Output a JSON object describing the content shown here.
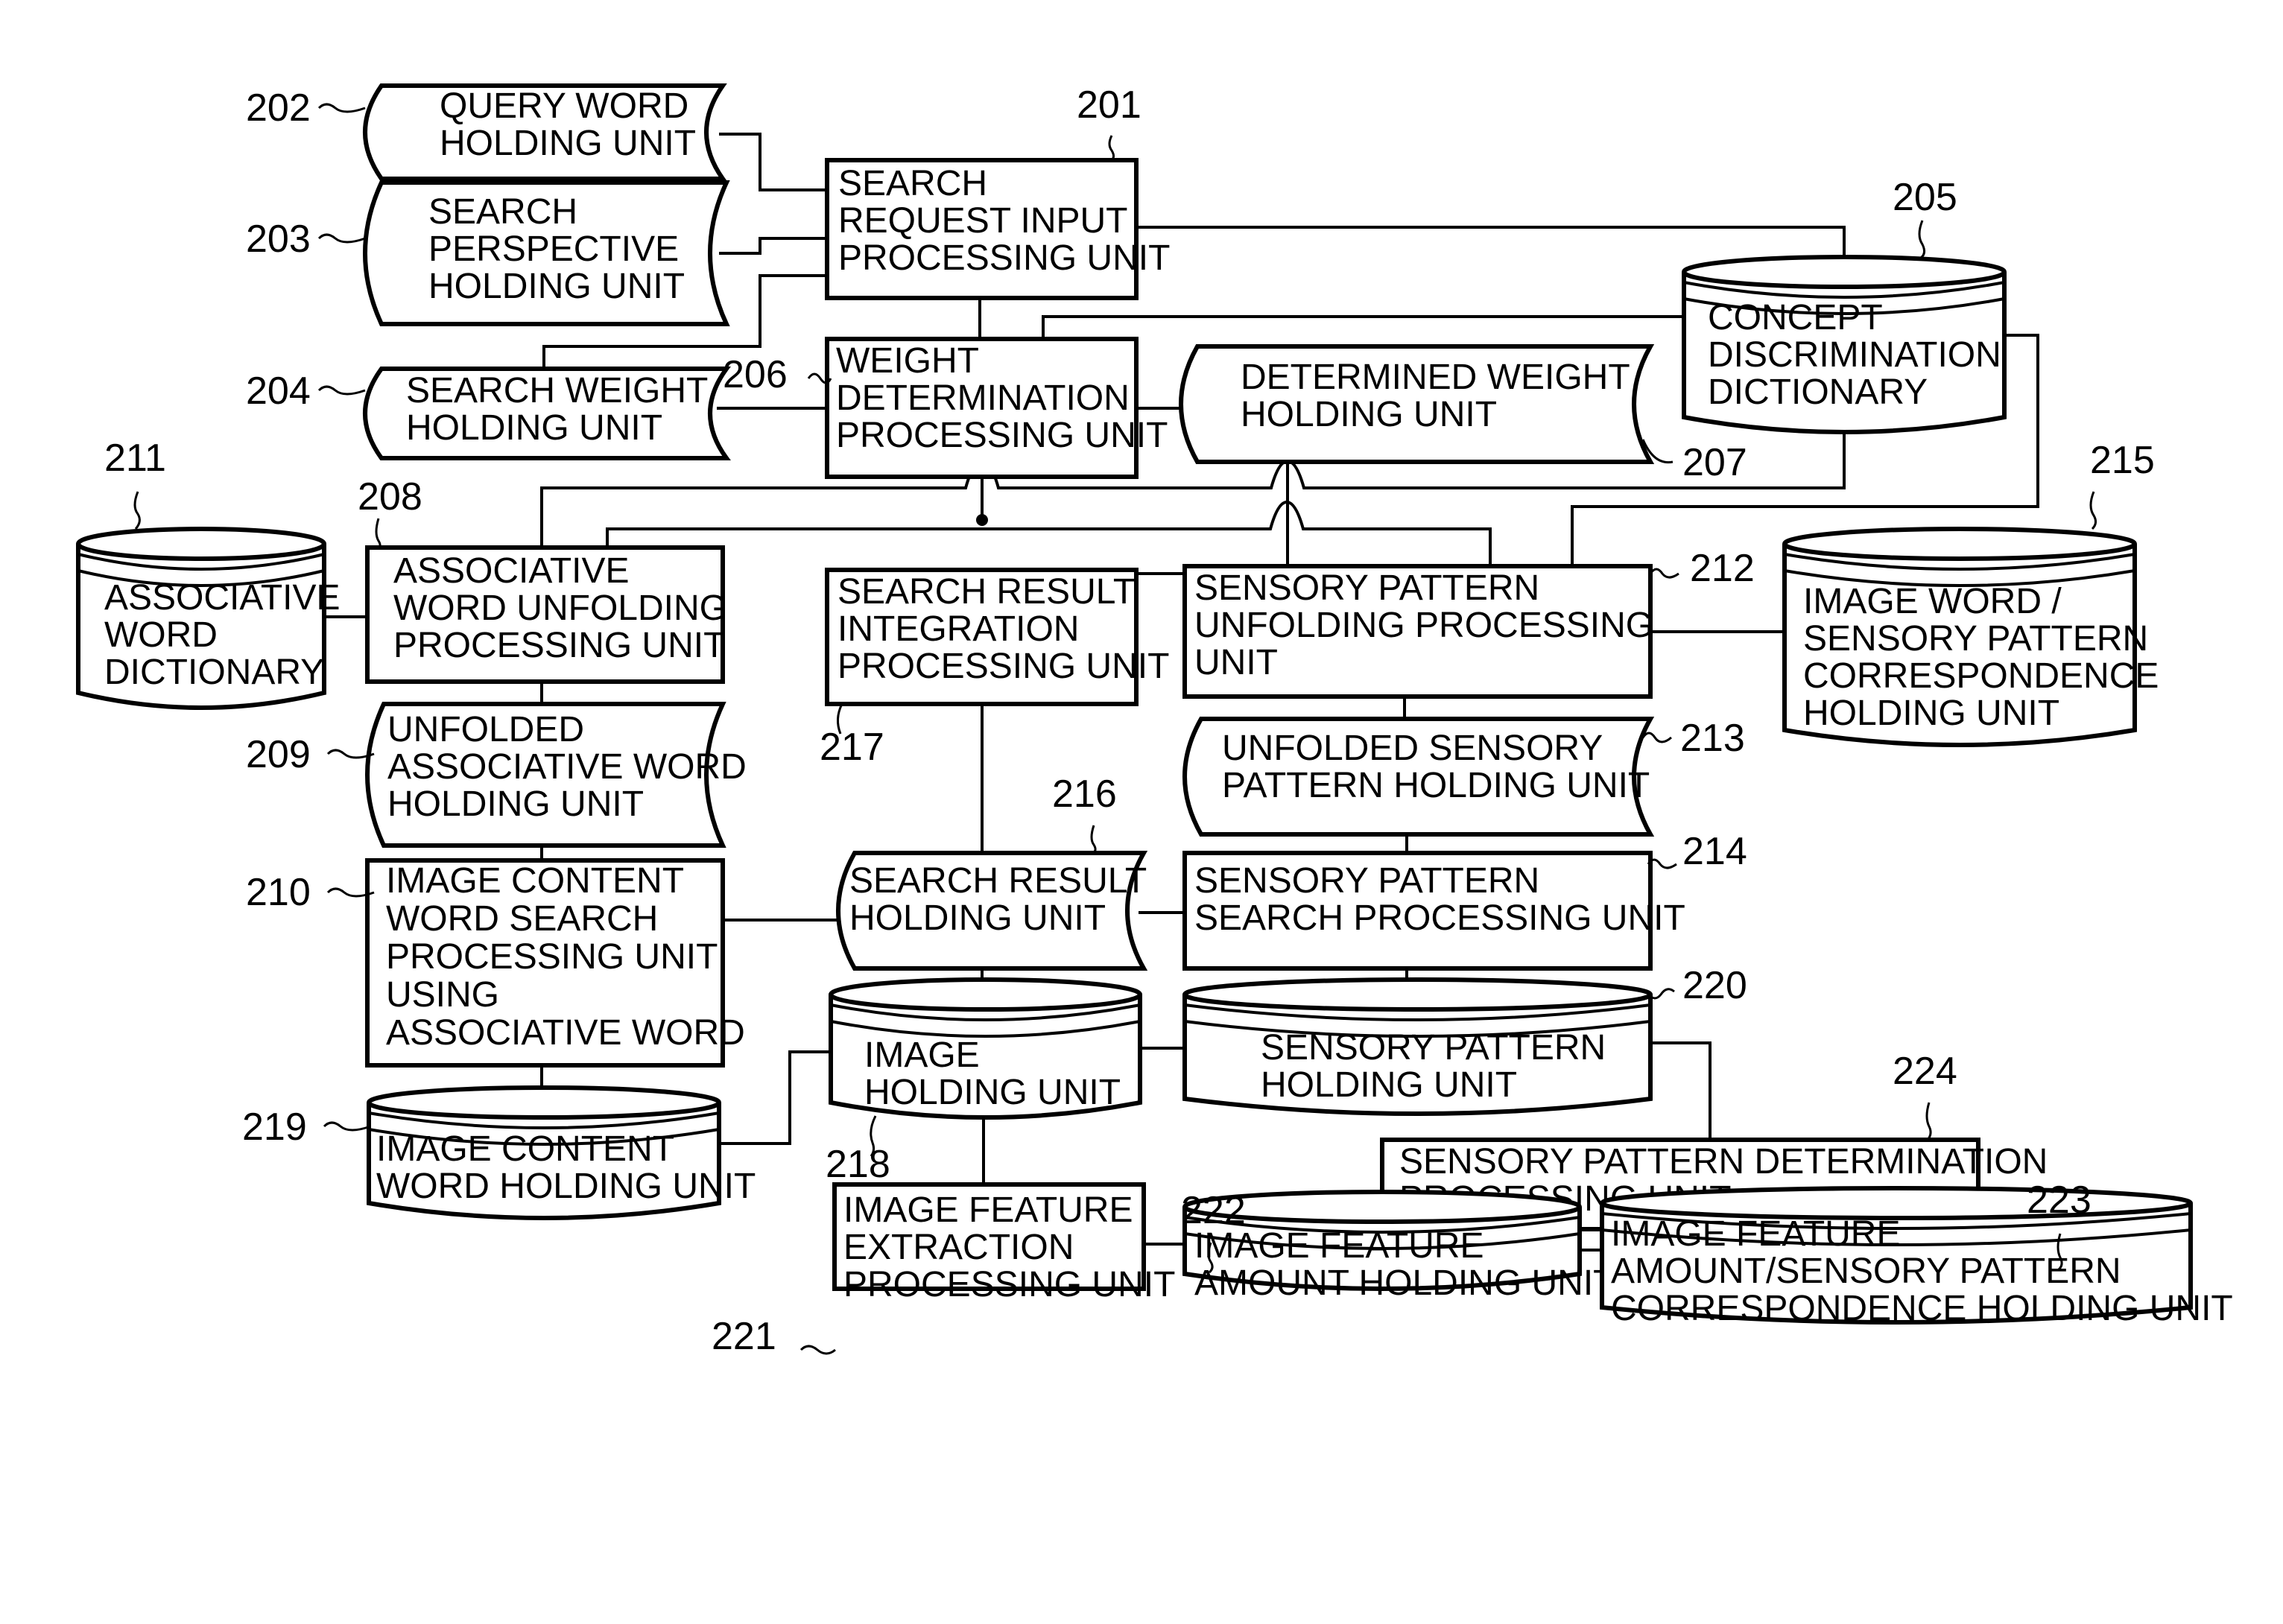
{
  "figure": {
    "type": "block-diagram",
    "description": "Image search system functional block diagram"
  },
  "nodes": {
    "n201": {
      "ref": "201",
      "shape": "process",
      "lines": [
        "SEARCH",
        "REQUEST INPUT",
        "PROCESSING UNIT"
      ]
    },
    "n202": {
      "ref": "202",
      "shape": "storage-tape",
      "lines": [
        "QUERY WORD",
        "HOLDING UNIT"
      ]
    },
    "n203": {
      "ref": "203",
      "shape": "storage-tape",
      "lines": [
        "SEARCH",
        "PERSPECTIVE",
        "HOLDING UNIT"
      ]
    },
    "n204": {
      "ref": "204",
      "shape": "storage-tape",
      "lines": [
        "SEARCH WEIGHT",
        "HOLDING UNIT"
      ]
    },
    "n205": {
      "ref": "205",
      "shape": "database",
      "lines": [
        "CONCEPT",
        "DISCRIMINATION",
        "DICTIONARY"
      ]
    },
    "n206": {
      "ref": "206",
      "shape": "process",
      "lines": [
        "WEIGHT",
        "DETERMINATION",
        "PROCESSING UNIT"
      ]
    },
    "n207": {
      "ref": "207",
      "shape": "storage-tape",
      "lines": [
        "DETERMINED WEIGHT",
        "HOLDING UNIT"
      ]
    },
    "n208": {
      "ref": "208",
      "shape": "process",
      "lines": [
        "ASSOCIATIVE",
        "WORD UNFOLDING",
        "PROCESSING UNIT"
      ]
    },
    "n209": {
      "ref": "209",
      "shape": "storage-tape",
      "lines": [
        "UNFOLDED",
        "ASSOCIATIVE WORD",
        "HOLDING UNIT"
      ]
    },
    "n210": {
      "ref": "210",
      "shape": "process",
      "lines": [
        "IMAGE CONTENT",
        "WORD SEARCH",
        "PROCESSING UNIT",
        "USING",
        "ASSOCIATIVE WORD"
      ]
    },
    "n211": {
      "ref": "211",
      "shape": "database",
      "lines": [
        "ASSOCIATIVE",
        "WORD",
        "DICTIONARY"
      ]
    },
    "n212": {
      "ref": "212",
      "shape": "process",
      "lines": [
        "SENSORY PATTERN",
        "UNFOLDING PROCESSING",
        "UNIT"
      ]
    },
    "n213": {
      "ref": "213",
      "shape": "storage-tape",
      "lines": [
        "UNFOLDED SENSORY",
        "PATTERN HOLDING UNIT"
      ]
    },
    "n214": {
      "ref": "214",
      "shape": "process",
      "lines": [
        "SENSORY PATTERN",
        "SEARCH PROCESSING UNIT"
      ]
    },
    "n215": {
      "ref": "215",
      "shape": "database",
      "lines": [
        "IMAGE WORD /",
        "SENSORY PATTERN",
        "CORRESPONDENCE",
        "HOLDING UNIT"
      ]
    },
    "n216": {
      "ref": "216",
      "shape": "storage-tape",
      "lines": [
        "SEARCH RESULT",
        "HOLDING UNIT"
      ]
    },
    "n217": {
      "ref": "217",
      "shape": "process",
      "lines": [
        "SEARCH RESULT",
        "INTEGRATION",
        "PROCESSING UNIT"
      ]
    },
    "n218": {
      "ref": "218",
      "shape": "database",
      "lines": [
        "IMAGE",
        "HOLDING UNIT"
      ]
    },
    "n219": {
      "ref": "219",
      "shape": "database",
      "lines": [
        "IMAGE CONTENT",
        "WORD HOLDING UNIT"
      ]
    },
    "n220": {
      "ref": "220",
      "shape": "database",
      "lines": [
        "SENSORY PATTERN",
        "HOLDING UNIT"
      ]
    },
    "n221": {
      "ref": "221",
      "shape": "process",
      "lines": [
        "IMAGE FEATURE",
        "EXTRACTION",
        "PROCESSING UNIT"
      ]
    },
    "n222": {
      "ref": "222",
      "shape": "database",
      "lines": [
        "IMAGE FEATURE",
        "AMOUNT HOLDING UNIT"
      ]
    },
    "n223": {
      "ref": "223",
      "shape": "database",
      "lines": [
        "IMAGE FEATURE",
        "AMOUNT/SENSORY PATTERN",
        "CORRESPONDENCE HOLDING UNIT"
      ]
    },
    "n224": {
      "ref": "224",
      "shape": "process",
      "lines": [
        "SENSORY PATTERN DETERMINATION",
        "PROCESSING UNIT"
      ]
    }
  },
  "edges": [
    [
      "202",
      "201"
    ],
    [
      "203",
      "201"
    ],
    [
      "204",
      "201"
    ],
    [
      "201",
      "205"
    ],
    [
      "201",
      "206"
    ],
    [
      "204",
      "206"
    ],
    [
      "206",
      "207"
    ],
    [
      "205",
      "206"
    ],
    [
      "205",
      "208"
    ],
    [
      "205",
      "215"
    ],
    [
      "211",
      "208"
    ],
    [
      "208",
      "209"
    ],
    [
      "209",
      "210"
    ],
    [
      "210",
      "216"
    ],
    [
      "210",
      "219"
    ],
    [
      "206",
      "208"
    ],
    [
      "206",
      "212"
    ],
    [
      "207",
      "217"
    ],
    [
      "212",
      "215"
    ],
    [
      "212",
      "213"
    ],
    [
      "213",
      "214"
    ],
    [
      "214",
      "216"
    ],
    [
      "217",
      "216"
    ],
    [
      "216",
      "218"
    ],
    [
      "214",
      "220"
    ],
    [
      "219",
      "218"
    ],
    [
      "218",
      "220"
    ],
    [
      "218",
      "221"
    ],
    [
      "221",
      "222"
    ],
    [
      "220",
      "224"
    ],
    [
      "224",
      "222"
    ],
    [
      "224",
      "223"
    ]
  ]
}
